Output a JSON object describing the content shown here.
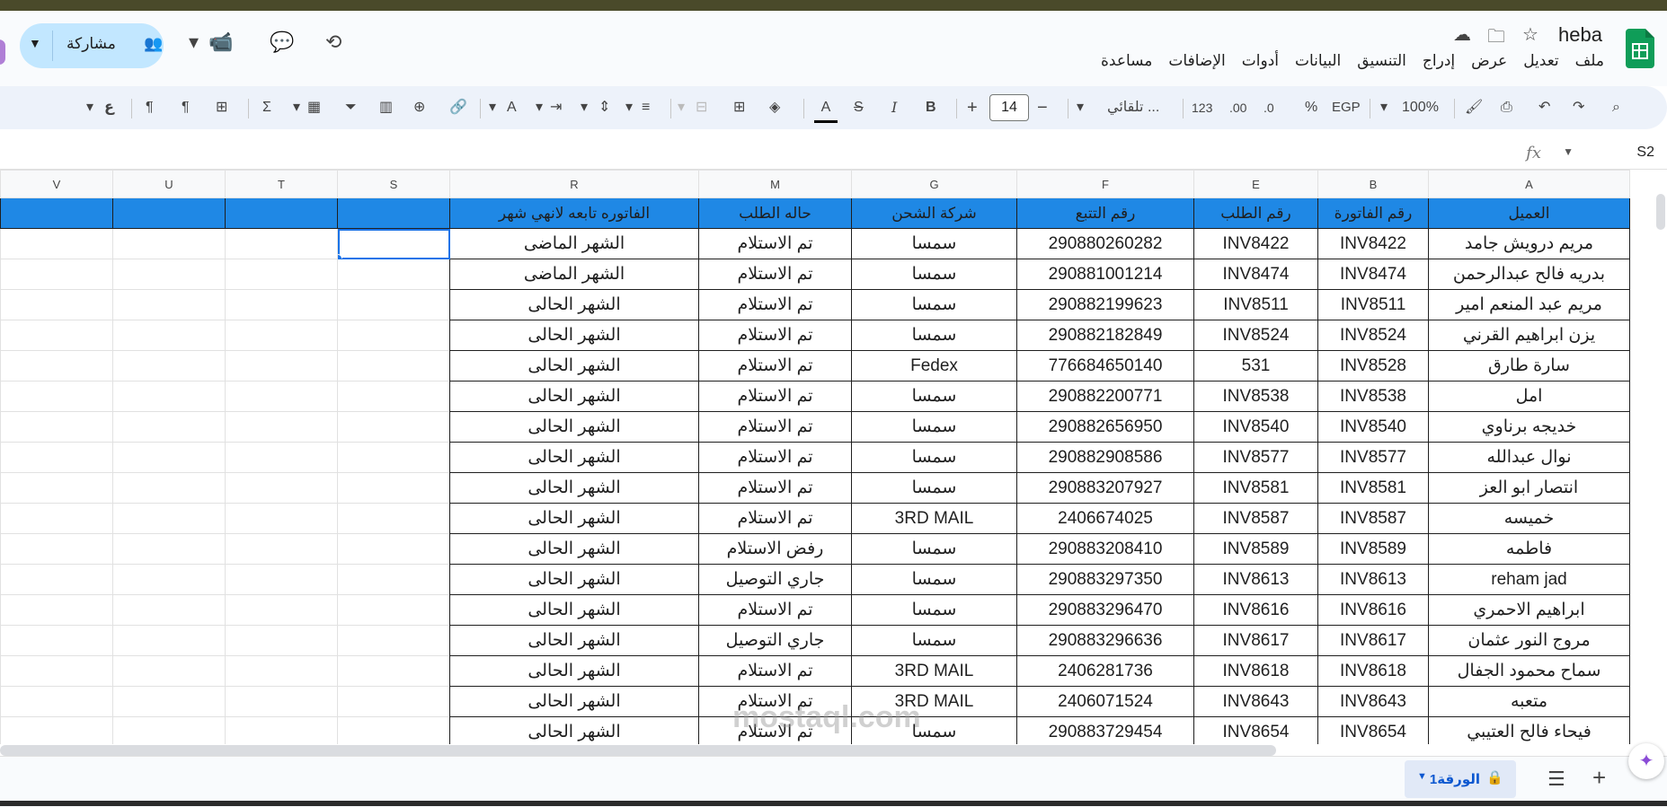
{
  "app": {
    "doc_title": "heba",
    "menu": [
      "ملف",
      "تعديل",
      "عرض",
      "إدراج",
      "التنسيق",
      "البيانات",
      "أدوات",
      "الإضافات",
      "مساعدة"
    ],
    "share_label": "مشاركة"
  },
  "toolbar": {
    "zoom": "100%",
    "currency": "EGP",
    "percent": "%",
    "dec_less": ".0",
    "dec_more": ".00",
    "format_123": "123",
    "font": "تلقائي ...",
    "font_size": "14",
    "bold": "B",
    "italic": "I",
    "underline_color": "A"
  },
  "formula_bar": {
    "cell_ref": "S2",
    "fx": "fx"
  },
  "columns": [
    "A",
    "B",
    "E",
    "F",
    "G",
    "M",
    "R",
    "S",
    "T",
    "U",
    "V"
  ],
  "selected_column": "S",
  "headers": [
    "العميل",
    "رقم الفاتورة",
    "رقم الطلب",
    "رقم التتبع",
    "شركة الشحن",
    "حاله الطلب",
    "الفاتوره تابعه لانهي شهر"
  ],
  "rows": [
    [
      "مريم درويش جامد",
      "INV8422",
      "INV8422",
      "290880260282",
      "سمسا",
      "تم الاستلام",
      "الشهر الماضى"
    ],
    [
      "بدريه فالح عبدالرحمن",
      "INV8474",
      "INV8474",
      "290881001214",
      "سمسا",
      "تم الاستلام",
      "الشهر الماضى"
    ],
    [
      "مريم عبد المنعم امير",
      "INV8511",
      "INV8511",
      "290882199623",
      "سمسا",
      "تم الاستلام",
      "الشهر الحالى"
    ],
    [
      "يزن ابراهيم القرني",
      "INV8524",
      "INV8524",
      "290882182849",
      "سمسا",
      "تم الاستلام",
      "الشهر الحالى"
    ],
    [
      "سارة طارق",
      "INV8528",
      "531",
      "776684650140",
      "Fedex",
      "تم الاستلام",
      "الشهر الحالى"
    ],
    [
      "امل",
      "INV8538",
      "INV8538",
      "290882200771",
      "سمسا",
      "تم الاستلام",
      "الشهر الحالى"
    ],
    [
      "خديجه برناوي",
      "INV8540",
      "INV8540",
      "290882656950",
      "سمسا",
      "تم الاستلام",
      "الشهر الحالى"
    ],
    [
      "نوال عبدالله",
      "INV8577",
      "INV8577",
      "290882908586",
      "سمسا",
      "تم الاستلام",
      "الشهر الحالى"
    ],
    [
      "انتصار ابو العز",
      "INV8581",
      "INV8581",
      "290883207927",
      "سمسا",
      "تم الاستلام",
      "الشهر الحالى"
    ],
    [
      "خميسه",
      "INV8587",
      "INV8587",
      "2406674025",
      "3RD MAIL",
      "تم الاستلام",
      "الشهر الحالى"
    ],
    [
      "فاطمه",
      "INV8589",
      "INV8589",
      "290883208410",
      "سمسا",
      "رفض الاستلام",
      "الشهر الحالى"
    ],
    [
      "reham jad",
      "INV8613",
      "INV8613",
      "290883297350",
      "سمسا",
      "جاري التوصيل",
      "الشهر الحالى"
    ],
    [
      "ابراهيم الاحمري",
      "INV8616",
      "INV8616",
      "290883296470",
      "سمسا",
      "تم الاستلام",
      "الشهر الحالى"
    ],
    [
      "مروج النور عثمان",
      "INV8617",
      "INV8617",
      "290883296636",
      "سمسا",
      "جاري التوصيل",
      "الشهر الحالى"
    ],
    [
      "سماح محمود الجفال",
      "INV8618",
      "INV8618",
      "2406281736",
      "3RD MAIL",
      "تم الاستلام",
      "الشهر الحالى"
    ],
    [
      "متعبه",
      "INV8643",
      "INV8643",
      "2406071524",
      "3RD MAIL",
      "تم الاستلام",
      "الشهر الحالى"
    ],
    [
      "فيحاء فالح العتيبي",
      "INV8654",
      "INV8654",
      "290883729454",
      "سمسا",
      "تم الاستلام",
      "الشهر الحالى"
    ]
  ],
  "sheet_tab": "الورقة1",
  "watermark": "mostaql.com",
  "colors": {
    "header_fill": "#1f88e5",
    "selection": "#1a73e8",
    "share_bg": "#c2e7ff"
  }
}
